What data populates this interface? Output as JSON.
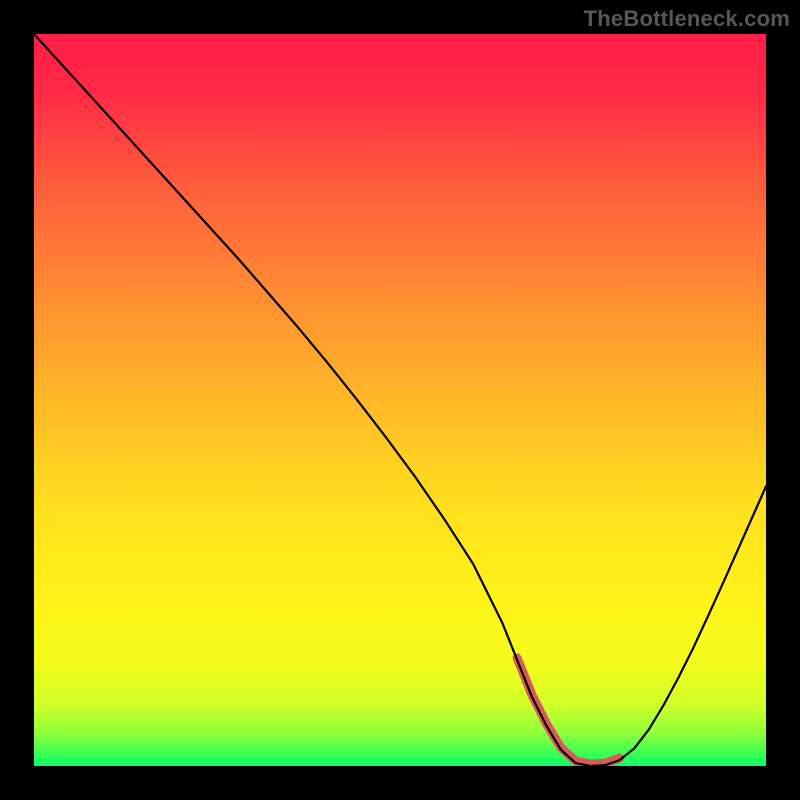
{
  "watermark": "TheBottleneck.com",
  "chart_data": {
    "type": "line",
    "title": "",
    "xlabel": "",
    "ylabel": "",
    "xlim": [
      0,
      100
    ],
    "ylim": [
      0,
      100
    ],
    "grid": false,
    "valley_range_pct": [
      66,
      80
    ],
    "series": [
      {
        "name": "curve",
        "x": [
          0,
          4,
          8,
          12,
          16,
          20,
          24,
          28,
          32,
          36,
          40,
          44,
          48,
          52,
          56,
          60,
          64,
          66,
          68,
          70,
          72,
          74,
          76,
          78,
          80,
          82,
          84,
          86,
          88,
          90,
          92,
          94,
          96,
          98,
          100
        ],
        "y": [
          100.0,
          95.6,
          91.2,
          86.8,
          82.4,
          78.0,
          73.6,
          69.2,
          64.6,
          60.0,
          55.2,
          50.2,
          45.0,
          39.6,
          33.8,
          27.6,
          19.5,
          14.5,
          9.5,
          5.5,
          2.2,
          0.4,
          0.0,
          0.1,
          0.8,
          2.4,
          5.0,
          8.3,
          12.0,
          16.0,
          20.3,
          24.7,
          29.2,
          33.7,
          38.2
        ]
      }
    ],
    "gradient_stops": [
      {
        "offset": 0.0,
        "color": "#ff1e47"
      },
      {
        "offset": 0.08,
        "color": "#ff2a45"
      },
      {
        "offset": 0.2,
        "color": "#ff5a3d"
      },
      {
        "offset": 0.35,
        "color": "#ff8b33"
      },
      {
        "offset": 0.5,
        "color": "#ffb928"
      },
      {
        "offset": 0.65,
        "color": "#ffe01e"
      },
      {
        "offset": 0.78,
        "color": "#fff41a"
      },
      {
        "offset": 0.86,
        "color": "#f3fb1c"
      },
      {
        "offset": 0.915,
        "color": "#d2ff28"
      },
      {
        "offset": 0.955,
        "color": "#8fff3a"
      },
      {
        "offset": 0.985,
        "color": "#35ff55"
      },
      {
        "offset": 1.0,
        "color": "#0cff63"
      }
    ],
    "highlight": {
      "color": "#d85a5a",
      "stroke_width": 9,
      "x_start": 66,
      "x_end": 80
    }
  }
}
